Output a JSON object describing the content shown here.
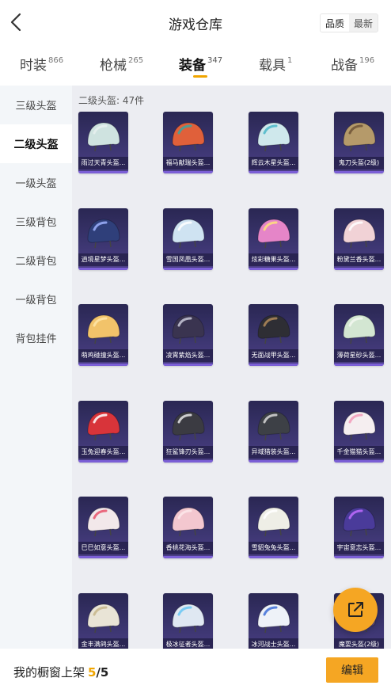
{
  "header": {
    "title": "游戏仓库",
    "sort_options": [
      "品质",
      "最新"
    ],
    "sort_selected": "品质"
  },
  "tabs": [
    {
      "label": "时装",
      "count": "866"
    },
    {
      "label": "枪械",
      "count": "265"
    },
    {
      "label": "装备",
      "count": "347",
      "active": true
    },
    {
      "label": "载具",
      "count": "1"
    },
    {
      "label": "战备",
      "count": "196"
    }
  ],
  "sidebar": {
    "items": [
      "三级头盔",
      "二级头盔",
      "一级头盔",
      "三级背包",
      "二级背包",
      "一级背包",
      "背包挂件"
    ],
    "selected": "二级头盔"
  },
  "main": {
    "count_label": "二级头盔: 47件",
    "items": [
      {
        "name": "雨过天青头盔...",
        "color": "#cfe3e0",
        "accent": "#e8f0ee"
      },
      {
        "name": "福马献瑞头盔...",
        "color": "#e0603a",
        "accent": "#3aa6a0"
      },
      {
        "name": "辉云木星头盔...",
        "color": "#cfe8ec",
        "accent": "#4ab7c9"
      },
      {
        "name": "鬼刀头盔(2级)",
        "color": "#b59a6a",
        "accent": "#6e5436"
      },
      {
        "name": "逍境星梦头盔...",
        "color": "#2f3f7a",
        "accent": "#9fb3ff"
      },
      {
        "name": "雪国凤凰头盔...",
        "color": "#cfe3f2",
        "accent": "#ffffff"
      },
      {
        "name": "炫彩糖果头盔...",
        "color": "#e585c8",
        "accent": "#ffe27a"
      },
      {
        "name": "粉黛兰香头盔...",
        "color": "#f1d2d6",
        "accent": "#ffffff"
      },
      {
        "name": "萌鸡碰撞头盔...",
        "color": "#f2c36a",
        "accent": "#ffe6a8"
      },
      {
        "name": "凌霄紫焰头盔...",
        "color": "#3a3450",
        "accent": "#c9c9d8"
      },
      {
        "name": "无面战甲头盔...",
        "color": "#2e2e34",
        "accent": "#b28a5a"
      },
      {
        "name": "薄荷星砂头盔...",
        "color": "#d3e6d2",
        "accent": "#f2f7f1"
      },
      {
        "name": "玉兔迎春头盔...",
        "color": "#d8343a",
        "accent": "#ffffff"
      },
      {
        "name": "狂鲨锋刃头盔...",
        "color": "#3b3b42",
        "accent": "#e6e6e6"
      },
      {
        "name": "异域猎装头盔...",
        "color": "#3d4046",
        "accent": "#d8d8d8"
      },
      {
        "name": "千金猫猫头盔...",
        "color": "#f5eef0",
        "accent": "#f29ab8"
      },
      {
        "name": "巳巳如意头盔...",
        "color": "#f2e8ea",
        "accent": "#e9526b"
      },
      {
        "name": "香桃花海头盔...",
        "color": "#f3c7cf",
        "accent": "#fbe7ea"
      },
      {
        "name": "雪貂兔兔头盔...",
        "color": "#eeeee6",
        "accent": "#ffffff"
      },
      {
        "name": "宇宙意志头盔...",
        "color": "#4a3b9a",
        "accent": "#c06cff"
      },
      {
        "name": "金丰满鸽头盔...",
        "color": "#e9e4d6",
        "accent": "#c7b68a"
      },
      {
        "name": "极冰征者头盔...",
        "color": "#dfe8f2",
        "accent": "#69c7f5"
      },
      {
        "name": "冰河战士头盔...",
        "color": "#eef2f8",
        "accent": "#3d6fd8"
      },
      {
        "name": "魔耍头盔(2级)",
        "color": "#5b4a78",
        "accent": "#f1c7ff"
      }
    ]
  },
  "bottom": {
    "showcase_label": "我的橱窗上架",
    "showcase_current": "5",
    "showcase_total": "/5",
    "edit_label": "编辑"
  },
  "icons": {
    "back": "chevron-left-icon",
    "share": "external-link-icon"
  }
}
